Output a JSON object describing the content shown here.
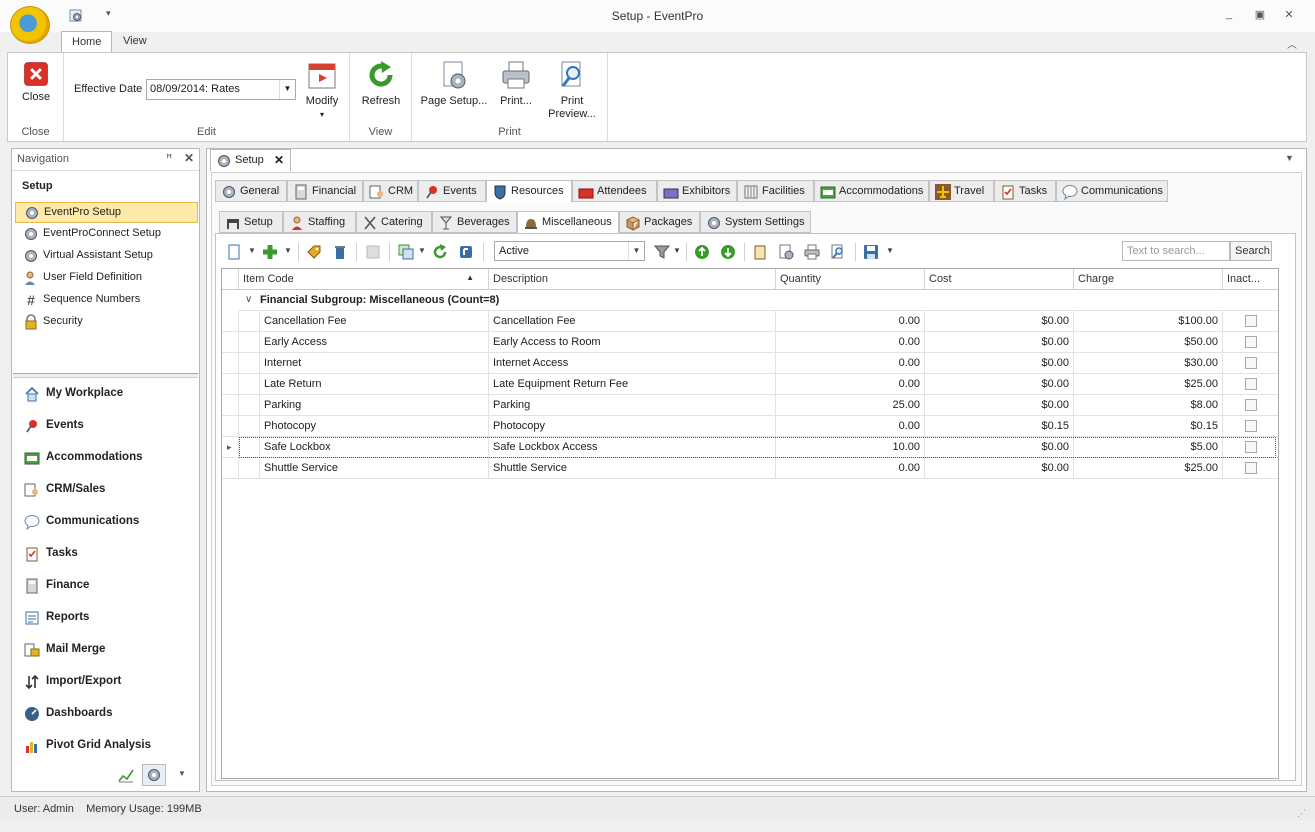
{
  "window": {
    "title": "Setup - EventPro"
  },
  "ribbon": {
    "tabs": [
      "Home",
      "View"
    ],
    "close_label": "Close",
    "close_group": "Close",
    "effective_date_label": "Effective Date",
    "effective_date_value": "08/09/2014: Rates",
    "modify_label": "Modify",
    "edit_group": "Edit",
    "refresh_label": "Refresh",
    "view_group": "View",
    "page_setup_label": "Page Setup...",
    "print_label": "Print...",
    "print_preview_label_1": "Print",
    "print_preview_label_2": "Preview...",
    "print_group": "Print"
  },
  "nav": {
    "header": "Navigation",
    "title": "Setup",
    "items": [
      {
        "label": "EventPro Setup",
        "icon": "gear-icon"
      },
      {
        "label": "EventProConnect Setup",
        "icon": "gear-icon"
      },
      {
        "label": "Virtual Assistant Setup",
        "icon": "gear-icon"
      },
      {
        "label": "User Field Definition",
        "icon": "user-icon"
      },
      {
        "label": "Sequence Numbers",
        "icon": "hash-icon"
      },
      {
        "label": "Security",
        "icon": "lock-icon"
      }
    ],
    "modules": [
      {
        "label": "My Workplace",
        "icon": "house-icon"
      },
      {
        "label": "Events",
        "icon": "pin-icon"
      },
      {
        "label": "Accommodations",
        "icon": "bed-icon"
      },
      {
        "label": "CRM/Sales",
        "icon": "crm-icon"
      },
      {
        "label": "Communications",
        "icon": "speech-bubble-icon"
      },
      {
        "label": "Tasks",
        "icon": "clipboard-icon"
      },
      {
        "label": "Finance",
        "icon": "calculator-icon"
      },
      {
        "label": "Reports",
        "icon": "report-icon"
      },
      {
        "label": "Mail Merge",
        "icon": "mail-merge-icon"
      },
      {
        "label": "Import/Export",
        "icon": "import-export-icon"
      },
      {
        "label": "Dashboards",
        "icon": "dashboard-icon"
      },
      {
        "label": "Pivot Grid Analysis",
        "icon": "pivot-chart-icon"
      }
    ]
  },
  "doc": {
    "tab_label": "Setup"
  },
  "tabs_top": [
    "General",
    "Financial",
    "CRM",
    "Events",
    "Resources",
    "Attendees",
    "Exhibitors",
    "Facilities",
    "Accommodations",
    "Travel",
    "Tasks",
    "Communications"
  ],
  "tabs_sub": [
    "Setup",
    "Staffing",
    "Catering",
    "Beverages",
    "Miscellaneous",
    "Packages",
    "System Settings"
  ],
  "toolbar": {
    "status_value": "Active",
    "search_placeholder": "Text to search...",
    "search_label": "Search"
  },
  "grid": {
    "columns": [
      "Item Code",
      "Description",
      "Quantity",
      "Cost",
      "Charge",
      "Inact..."
    ],
    "group_label": "Financial Subgroup: Miscellaneous (Count=8)",
    "rows": [
      {
        "code": "Cancellation Fee",
        "desc": "Cancellation Fee",
        "qty": "0.00",
        "cost": "$0.00",
        "charge": "$100.00",
        "inactive": false
      },
      {
        "code": "Early Access",
        "desc": "Early Access to Room",
        "qty": "0.00",
        "cost": "$0.00",
        "charge": "$50.00",
        "inactive": false
      },
      {
        "code": "Internet",
        "desc": "Internet Access",
        "qty": "0.00",
        "cost": "$0.00",
        "charge": "$30.00",
        "inactive": false
      },
      {
        "code": "Late Return",
        "desc": "Late Equipment Return Fee",
        "qty": "0.00",
        "cost": "$0.00",
        "charge": "$25.00",
        "inactive": false
      },
      {
        "code": "Parking",
        "desc": "Parking",
        "qty": "25.00",
        "cost": "$0.00",
        "charge": "$8.00",
        "inactive": false
      },
      {
        "code": "Photocopy",
        "desc": "Photocopy",
        "qty": "0.00",
        "cost": "$0.15",
        "charge": "$0.15",
        "inactive": false
      },
      {
        "code": "Safe Lockbox",
        "desc": "Safe Lockbox Access",
        "qty": "10.00",
        "cost": "$0.00",
        "charge": "$5.00",
        "inactive": false
      },
      {
        "code": "Shuttle Service",
        "desc": "Shuttle Service",
        "qty": "0.00",
        "cost": "$0.00",
        "charge": "$25.00",
        "inactive": false
      }
    ]
  },
  "status": {
    "text": "User: Admin    Memory Usage: 199MB"
  }
}
